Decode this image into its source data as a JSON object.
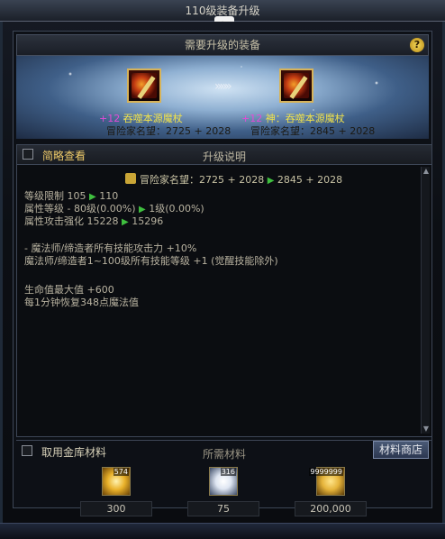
{
  "window": {
    "title": "110级装备升级"
  },
  "header": {
    "section_title": "需要升级的装备",
    "help": "?"
  },
  "items": {
    "from": {
      "plus": "+12",
      "name": "吞噬本源魔杖",
      "fame": "冒险家名望：2725 + 2028"
    },
    "to": {
      "plus": "+12",
      "name": "神：吞噬本源魔杖",
      "fame": "冒险家名望：2845 + 2028"
    },
    "arrow": "»»»"
  },
  "description": {
    "brief_label": "简略查看",
    "title": "升级说明",
    "fame_line": {
      "before": "冒险家名望：2725 + 2028",
      "after": "2845 + 2028"
    },
    "lines": [
      {
        "text": "等级限制 105",
        "to": "110"
      },
      {
        "text": "属性等级 - 80级(0.00%)",
        "to": "1级(0.00%)"
      },
      {
        "text": "属性攻击强化 15228",
        "to": "15296"
      }
    ],
    "effects": [
      "- 魔法师/缔造者所有技能攻击力 +10%",
      "魔法师/缔造者1~100级所有技能等级 +1 (觉醒技能除外)",
      "生命值最大值 +600",
      "每1分钟恢复348点魔法值"
    ]
  },
  "materials": {
    "use_vault_label": "取用金库材料",
    "title": "所需材料",
    "shop_label": "材料商店",
    "list": [
      {
        "count_badge": "574",
        "required": "300",
        "icon": "gold-crystal-icon",
        "color": "#e9b12a"
      },
      {
        "count_badge": "316",
        "required": "75",
        "icon": "white-orb-icon",
        "color": "#dfe6f2"
      },
      {
        "count_badge": "9999999",
        "required": "200,000",
        "icon": "gold-coins-icon",
        "color": "#e5b33a"
      }
    ]
  }
}
